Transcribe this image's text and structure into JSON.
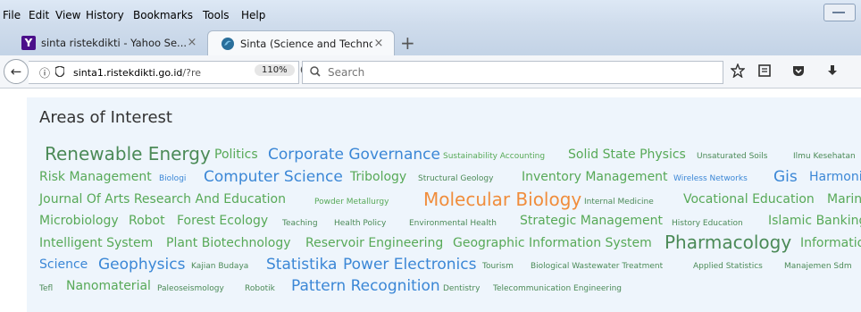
{
  "menubar": {
    "items": [
      "File",
      "Edit",
      "View",
      "History",
      "Bookmarks",
      "Tools",
      "Help"
    ]
  },
  "tabs": [
    {
      "title": "sinta ristekdikti - Yahoo Se...",
      "close": "×",
      "favicon": "Y"
    },
    {
      "title": "Sinta (Science and Technol...",
      "close": "×"
    }
  ],
  "newtab": "+",
  "nav": {
    "back": "←",
    "info": "ⓘ",
    "shield": "🛡",
    "url_host": "sinta1.ristekdikti.go.id",
    "url_path": "/?re",
    "zoom": "110%",
    "reload": "C",
    "search_placeholder": "Search",
    "toolbar_icons": [
      "star-icon",
      "reader-icon",
      "pocket-icon",
      "download-icon"
    ]
  },
  "page": {
    "heading": "Areas of Interest",
    "tags": [
      "Renewable Energy",
      "Politics",
      "Corporate Governance",
      "Sustainability Accounting",
      "Solid State Physics",
      "Unsaturated Soils",
      "Ilmu Kesehatan",
      "Risk Management",
      "Biologi",
      "Computer Science",
      "Tribology",
      "Structural Geology",
      "Inventory Management",
      "Wireless Networks",
      "Gis",
      "Harmonic",
      "Journal Of Arts Research And Education",
      "Powder Metallurgy",
      "Molecular Biology",
      "Internal Medicine",
      "Vocational Education",
      "Marine",
      "Microbiology",
      "Robot",
      "Forest Ecology",
      "Teaching",
      "Health Policy",
      "Environmental Health",
      "Strategic Management",
      "History Education",
      "Islamic Banking",
      "Intelligent System",
      "Plant Biotechnology",
      "Reservoir Engineering",
      "Geographic Information System",
      "Pharmacology",
      "Information",
      "Science",
      "Geophysics",
      "Kajian Budaya",
      "Statistika",
      "Power Electronics",
      "Tourism",
      "Biological Wastewater Treatment",
      "Applied Statistics",
      "Manajemen Sdm",
      "Tefl",
      "Nanomaterial",
      "Paleoseismology",
      "Robotik",
      "Pattern Recognition",
      "Dentistry",
      "Telecommunication Engineering"
    ]
  }
}
